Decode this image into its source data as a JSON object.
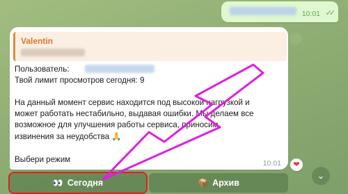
{
  "outgoing": {
    "text": "████████████████",
    "time": "10:01",
    "status_icon": "double-check-icon"
  },
  "incoming": {
    "reply_name": "Valentin",
    "reply_preview": "████████████",
    "user_label": "Пользователь:",
    "user_value": "████████████████",
    "limit_line": "Твой лимит просмотров сегодня: 9",
    "body_lines": [
      "На данный момент сервис находится под высокой нагрузкой и",
      "может работать нестабильно, выдавая ошибки. Мы делаем все",
      "возможное для улучшения работы сервиса, приносим",
      "извинения за неудобства 🙏"
    ],
    "prompt": "Выбери режим",
    "time": "10:01",
    "reaction": "❤"
  },
  "keyboard": {
    "today": {
      "emoji": "👀",
      "label": "Сегодня"
    },
    "archive": {
      "emoji": "📦",
      "label": "Архив"
    }
  },
  "annotations": {
    "arrow_color": "#e01ee0",
    "highlight_color": "#e01e1e"
  }
}
